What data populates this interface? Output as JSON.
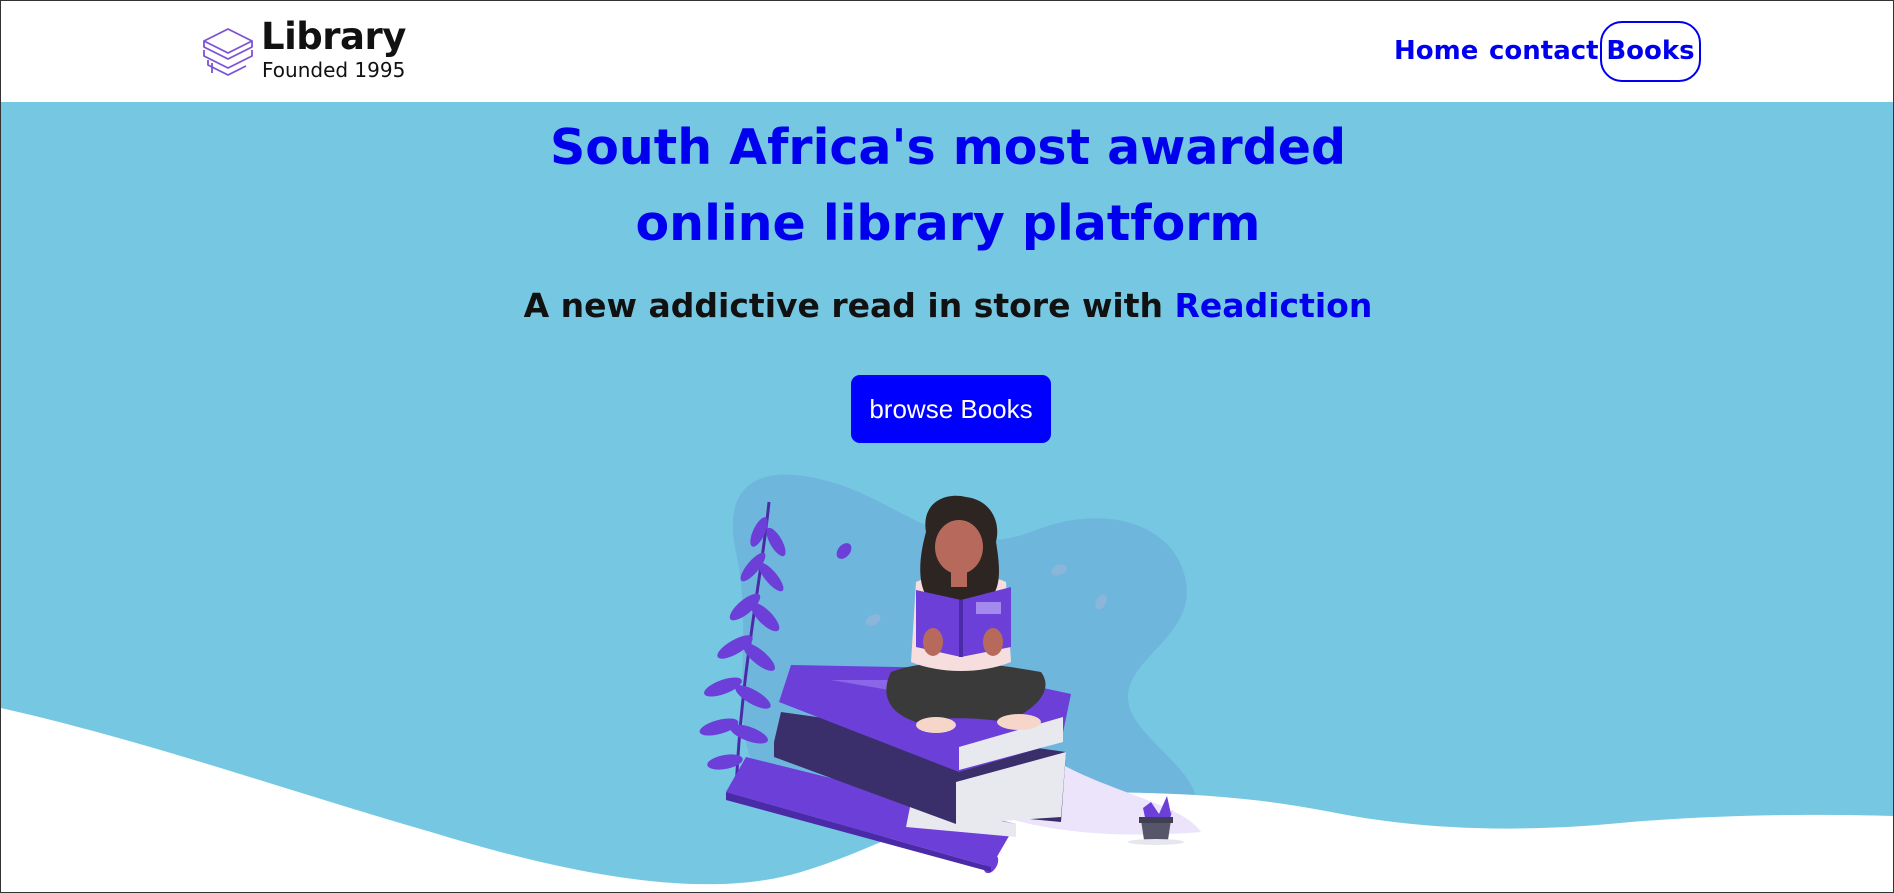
{
  "header": {
    "logo_title": "Library",
    "logo_subtitle": "Founded 1995",
    "nav": {
      "home": "Home",
      "contact": "contact",
      "books": "Books"
    }
  },
  "hero": {
    "headline_line1": "South Africa's most awarded",
    "headline_line2": "online library platform",
    "tagline_prefix": "A new addictive read in store with ",
    "tagline_brand": "Readiction",
    "cta_label": "browse Books"
  },
  "icons": {
    "logo": "stacked-books-icon",
    "illustration": "woman-reading-on-books-illustration"
  },
  "colors": {
    "accent": "#0000ee",
    "hero_background": "#75c7e2",
    "cta_background": "#0000ff",
    "illustration_purple": "#6c3fd8"
  }
}
